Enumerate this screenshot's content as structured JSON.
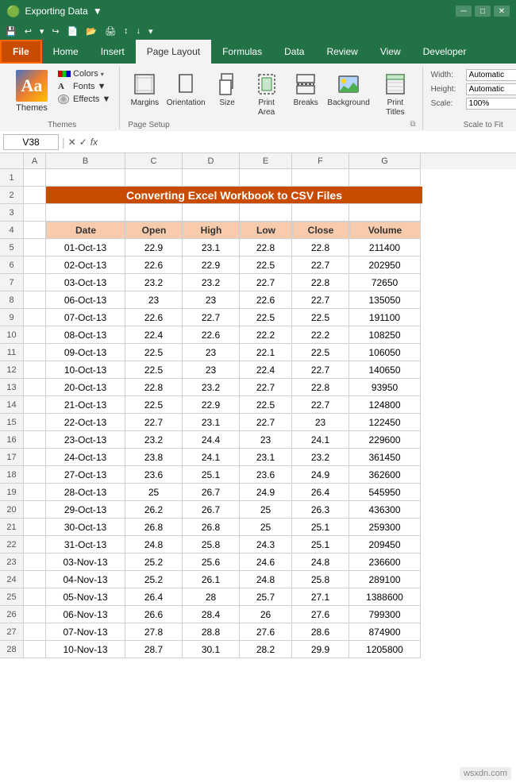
{
  "app": {
    "title": "Exporting Data",
    "title_suffix": " ▼"
  },
  "tabs": {
    "file": "File",
    "home": "Home",
    "insert": "Insert",
    "page_layout": "Page Layout",
    "formulas": "Formulas",
    "data": "Data",
    "review": "Review",
    "view": "View",
    "developer": "Developer"
  },
  "themes_group": {
    "label": "Themes",
    "themes_btn": "Aa",
    "themes_text": "Themes",
    "colors": "Colors",
    "fonts": "Fonts ▼",
    "effects": "Effects ▼"
  },
  "page_setup_group": {
    "label": "Page Setup",
    "margins": "Margins",
    "orientation": "Orientation",
    "size": "Size",
    "print_area": "Print\nArea",
    "breaks": "Breaks",
    "background": "Background",
    "print_titles": "Print\nTitles"
  },
  "scale_group": {
    "label": "Scale to Fit",
    "width_label": "Width:",
    "height_label": "Height:",
    "scale_label": "Scale:",
    "width_value": "Automatic",
    "height_value": "Automatic",
    "scale_value": "100%"
  },
  "formula_bar": {
    "name_box": "V38",
    "formula_content": ""
  },
  "col_headers": [
    "A",
    "B",
    "C",
    "D",
    "E",
    "F",
    "G"
  ],
  "spreadsheet": {
    "title": "Converting Excel Workbook to CSV Files",
    "headers": [
      "Date",
      "Open",
      "High",
      "Low",
      "Close",
      "Volume"
    ],
    "rows": [
      [
        "01-Oct-13",
        "22.9",
        "23.1",
        "22.8",
        "22.8",
        "211400"
      ],
      [
        "02-Oct-13",
        "22.6",
        "22.9",
        "22.5",
        "22.7",
        "202950"
      ],
      [
        "03-Oct-13",
        "23.2",
        "23.2",
        "22.7",
        "22.8",
        "72650"
      ],
      [
        "06-Oct-13",
        "23",
        "23",
        "22.6",
        "22.7",
        "135050"
      ],
      [
        "07-Oct-13",
        "22.6",
        "22.7",
        "22.5",
        "22.5",
        "191100"
      ],
      [
        "08-Oct-13",
        "22.4",
        "22.6",
        "22.2",
        "22.2",
        "108250"
      ],
      [
        "09-Oct-13",
        "22.5",
        "23",
        "22.1",
        "22.5",
        "106050"
      ],
      [
        "10-Oct-13",
        "22.5",
        "23",
        "22.4",
        "22.7",
        "140650"
      ],
      [
        "20-Oct-13",
        "22.8",
        "23.2",
        "22.7",
        "22.8",
        "93950"
      ],
      [
        "21-Oct-13",
        "22.5",
        "22.9",
        "22.5",
        "22.7",
        "124800"
      ],
      [
        "22-Oct-13",
        "22.7",
        "23.1",
        "22.7",
        "23",
        "122450"
      ],
      [
        "23-Oct-13",
        "23.2",
        "24.4",
        "23",
        "24.1",
        "229600"
      ],
      [
        "24-Oct-13",
        "23.8",
        "24.1",
        "23.1",
        "23.2",
        "361450"
      ],
      [
        "27-Oct-13",
        "23.6",
        "25.1",
        "23.6",
        "24.9",
        "362600"
      ],
      [
        "28-Oct-13",
        "25",
        "26.7",
        "24.9",
        "26.4",
        "545950"
      ],
      [
        "29-Oct-13",
        "26.2",
        "26.7",
        "25",
        "26.3",
        "436300"
      ],
      [
        "30-Oct-13",
        "26.8",
        "26.8",
        "25",
        "25.1",
        "259300"
      ],
      [
        "31-Oct-13",
        "24.8",
        "25.8",
        "24.3",
        "25.1",
        "209450"
      ],
      [
        "03-Nov-13",
        "25.2",
        "25.6",
        "24.6",
        "24.8",
        "236600"
      ],
      [
        "04-Nov-13",
        "25.2",
        "26.1",
        "24.8",
        "25.8",
        "289100"
      ],
      [
        "05-Nov-13",
        "26.4",
        "28",
        "25.7",
        "27.1",
        "1388600"
      ],
      [
        "06-Nov-13",
        "26.6",
        "28.4",
        "26",
        "27.6",
        "799300"
      ],
      [
        "07-Nov-13",
        "27.8",
        "28.8",
        "27.6",
        "28.6",
        "874900"
      ],
      [
        "10-Nov-13",
        "28.7",
        "30.1",
        "28.2",
        "29.9",
        "1205800"
      ]
    ],
    "row_start": 1
  },
  "watermark": "wsxdn.com"
}
